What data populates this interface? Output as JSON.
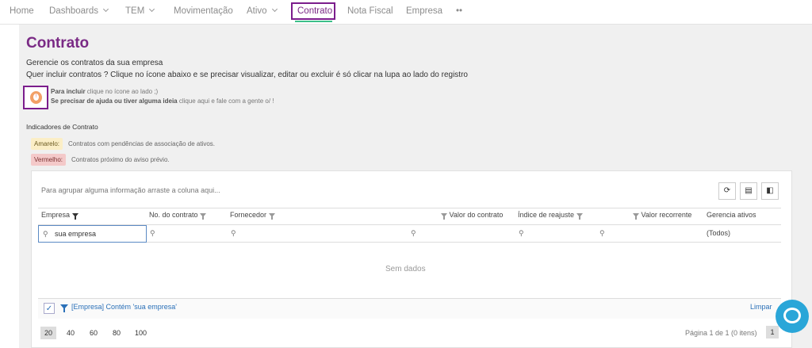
{
  "nav": {
    "items": [
      "Home",
      "Dashboards",
      "TEM",
      "Movimentação",
      "Ativo",
      "Contrato",
      "Nota Fiscal",
      "Empresa",
      "••"
    ]
  },
  "title": "Contrato",
  "desc1": "Gerencie os contratos da sua empresa",
  "desc2": "Quer incluir contratos ? Clique no ícone abaixo e se precisar visualizar, editar ou excluir é só clicar na lupa ao lado do registro",
  "hint1_bold": "Para incluir",
  "hint1": " clique no ícone ao lado ;)",
  "hint2_bold": "Se precisar de ajuda ou tiver alguma ideia",
  "hint2": " clique aqui e fale com a gente o/ !",
  "indicators": {
    "title": "Indicadores de Contrato",
    "yellow_label": "Amarelo:",
    "yellow_text": "Contratos com pendências de associação de ativos.",
    "red_label": "Vermelho:",
    "red_text": "Contratos próximo do aviso prévio."
  },
  "grid": {
    "group_panel": "Para agrupar alguma informação arraste a coluna aqui...",
    "columns": [
      "Empresa",
      "No. do contrato",
      "Fornecedor",
      "Valor do contrato",
      "Índice de reajuste",
      "Valor recorrente",
      "Gerencia ativos"
    ],
    "search_value": "sua empresa",
    "gerencia_filter": "(Todos)",
    "empty": "Sem dados",
    "filter_expr": "[Empresa] Contém 'sua empresa'",
    "clear": "Limpar",
    "page_sizes": [
      "20",
      "40",
      "60",
      "80",
      "100"
    ],
    "page_info": "Página 1 de 1 (0 itens)",
    "page": "1"
  }
}
